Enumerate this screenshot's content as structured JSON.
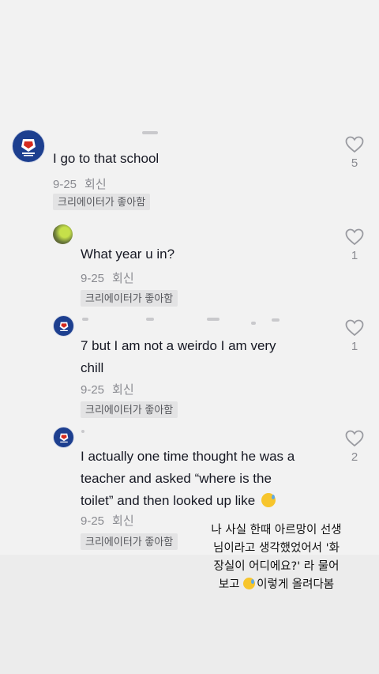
{
  "comments": [
    {
      "text": "I go to that school",
      "date": "9-25",
      "reply_label": "회신",
      "badge": "크리에이터가 좋아함",
      "likes": "5",
      "avatar_icon": "party-logo-icon"
    },
    {
      "text": "What year u in?",
      "date": "9-25",
      "reply_label": "회신",
      "badge": "크리에이터가 좋아함",
      "likes": "1",
      "avatar_icon": "photo-avatar"
    },
    {
      "text_line1": "7 but I am not a weirdo I am very",
      "text_line2": "chill",
      "date": "9-25",
      "reply_label": "회신",
      "badge": "크리에이터가 좋아함",
      "likes": "1",
      "avatar_icon": "party-logo-icon"
    },
    {
      "text_line1": "I actually one time thought he was a",
      "text_line2": "teacher and asked “where is the",
      "text_line3": "toilet” and then looked up like",
      "date": "9-25",
      "reply_label": "회신",
      "badge": "크리에이터가 좋아함",
      "likes": "2",
      "avatar_icon": "party-logo-icon"
    }
  ],
  "caption": {
    "line1": "나 사실 한때 아르망이 선생",
    "line2": "님이라고 생각했었어서 '화",
    "line3": "장실이 어디에요?' 라 물어",
    "line4_before": "보고",
    "line4_after": "이렇게 올려다봄"
  },
  "colors": {
    "background": "#f2f2f2",
    "text": "#161823",
    "meta": "#8a8b91",
    "badge_bg": "#e3e3e4",
    "avatar_blue": "#1d3f8f",
    "emoji_yellow": "#f7c52c"
  },
  "icons": {
    "like": "heart-outline-icon",
    "emoji": "grinning-sweat-emoji"
  }
}
